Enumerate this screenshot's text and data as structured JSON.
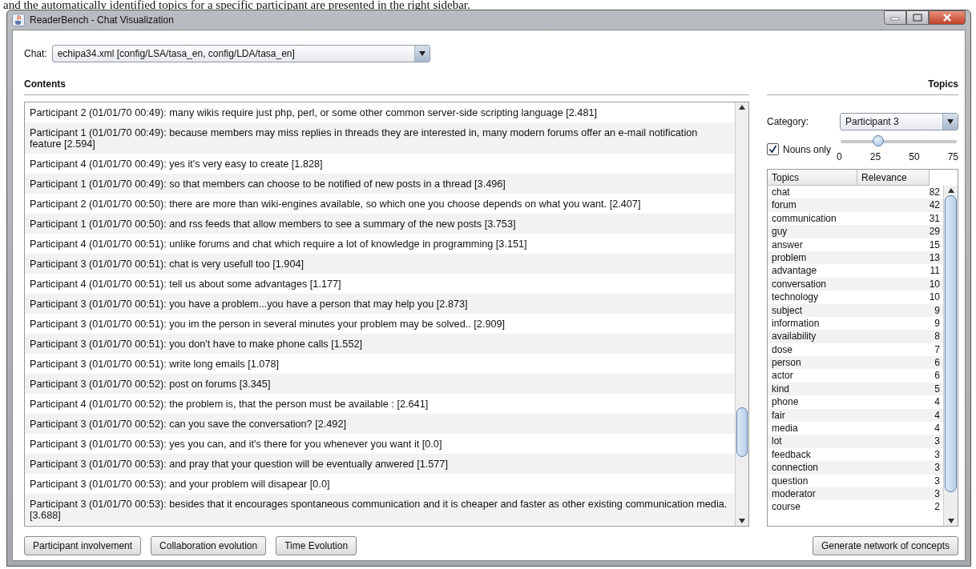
{
  "caption": "and the automatically identified topics for a specific participant are presented in the right sidebar.",
  "window": {
    "title": "ReaderBench - Chat Visualization"
  },
  "chat_selector": {
    "label": "Chat:",
    "value": "echipa34.xml [config/LSA/tasa_en, config/LDA/tasa_en]"
  },
  "contents": {
    "heading": "Contents",
    "messages": [
      {
        "text": "Participant 2 (01/01/70 00:49): many wikis require just php, perl, or some other common server-side scripting language [2.481]"
      },
      {
        "text": "Participant 1 (01/01/70 00:49): because members may miss replies in threads they are interested in, many modern forums offer an e-mail notification feature [2.594]"
      },
      {
        "text": "Participant 4 (01/01/70 00:49): yes it's very easy to create [1.828]"
      },
      {
        "text": "Participant 1 (01/01/70 00:49): so that members can choose to be notified of new posts in a thread [3.496]"
      },
      {
        "text": "Participant 2 (01/01/70 00:50): there are more than wiki-engines available, so which one you choose depends on what you want. [2.407]"
      },
      {
        "text": "Participant 1 (01/01/70 00:50): and rss feeds that allow members to see a summary of the new posts [3.753]"
      },
      {
        "text": "Participant 4 (01/01/70 00:51): unlike forums and chat which require a lot of knowledge in programming [3.151]"
      },
      {
        "text": "Participant 3 (01/01/70 00:51): chat is very usefull too [1.904]"
      },
      {
        "text": "Participant 4 (01/01/70 00:51): tell us about some advantages [1.177]"
      },
      {
        "text": "Participant 3 (01/01/70 00:51): you have a problem...you have a person that may help you [2.873]"
      },
      {
        "text": "Participant 3 (01/01/70 00:51): you im the person in several minutes your problem may be solved.. [2.909]"
      },
      {
        "text": "Participant 3 (01/01/70 00:51): you don't have to make phone calls [1.552]"
      },
      {
        "text": "Participant 3 (01/01/70 00:51): write long emails [1.078]"
      },
      {
        "text": "Participant 3 (01/01/70 00:52): post on forums [3.345]"
      },
      {
        "text": "Participant 4 (01/01/70 00:52): the problem is, that the person must be available : [2.641]"
      },
      {
        "text": "Participant 3 (01/01/70 00:52): can you save the conversation? [2.492]"
      },
      {
        "text": "Participant 3 (01/01/70 00:53): yes you can, and it's there for you whenever you want it [0.0]"
      },
      {
        "text": "Participant 3 (01/01/70 00:53): and pray that your question will be eventually anwered [1.577]"
      },
      {
        "text": "Participant 3 (01/01/70 00:53): and your problem will disapear [0.0]"
      },
      {
        "text": "Participant 3 (01/01/70 00:53): besides that it encourages spontaneous communication and it is cheaper and faster as other existing communication media. [3.688]"
      }
    ]
  },
  "topics": {
    "heading": "Topics",
    "category_label": "Category:",
    "category_value": "Participant 3",
    "nouns_only": {
      "label": "Nouns only",
      "checked": true
    },
    "slider": {
      "level": 0.3333,
      "ticks": [
        "0",
        "25",
        "50",
        "75"
      ]
    },
    "columns": [
      "Topics",
      "Relevance"
    ],
    "rows": [
      {
        "topic": "chat",
        "relevance": "82"
      },
      {
        "topic": "forum",
        "relevance": "42"
      },
      {
        "topic": "communication",
        "relevance": "31"
      },
      {
        "topic": "guy",
        "relevance": "29"
      },
      {
        "topic": "answer",
        "relevance": "15"
      },
      {
        "topic": "problem",
        "relevance": "13"
      },
      {
        "topic": "advantage",
        "relevance": "11"
      },
      {
        "topic": "conversation",
        "relevance": "10"
      },
      {
        "topic": "technology",
        "relevance": "10"
      },
      {
        "topic": "subject",
        "relevance": "9"
      },
      {
        "topic": "information",
        "relevance": "9"
      },
      {
        "topic": "availability",
        "relevance": "8"
      },
      {
        "topic": "dose",
        "relevance": "7"
      },
      {
        "topic": "person",
        "relevance": "6"
      },
      {
        "topic": "actor",
        "relevance": "6"
      },
      {
        "topic": "kind",
        "relevance": "5"
      },
      {
        "topic": "phone",
        "relevance": "4"
      },
      {
        "topic": "fair",
        "relevance": "4"
      },
      {
        "topic": "media",
        "relevance": "4"
      },
      {
        "topic": "lot",
        "relevance": "3"
      },
      {
        "topic": "feedback",
        "relevance": "3"
      },
      {
        "topic": "connection",
        "relevance": "3"
      },
      {
        "topic": "question",
        "relevance": "3"
      },
      {
        "topic": "moderator",
        "relevance": "3"
      },
      {
        "topic": "course",
        "relevance": "2"
      }
    ]
  },
  "buttons": [
    "Participant involvement",
    "Collaboration evolution",
    "Time Evolution"
  ],
  "generate_button": "Generate network of concepts"
}
